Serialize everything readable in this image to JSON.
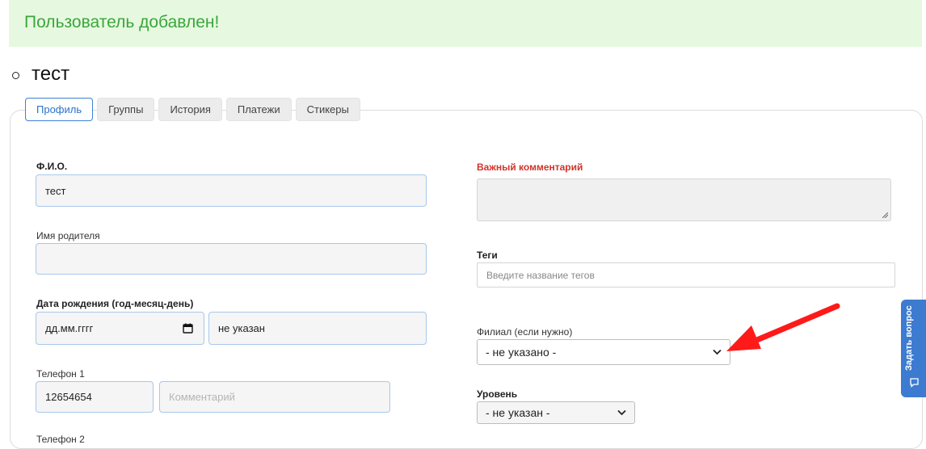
{
  "alert": {
    "message": "Пользователь добавлен!"
  },
  "page": {
    "title": "тест"
  },
  "tabs": [
    {
      "label": "Профиль",
      "active": true
    },
    {
      "label": "Группы",
      "active": false
    },
    {
      "label": "История",
      "active": false
    },
    {
      "label": "Платежи",
      "active": false
    },
    {
      "label": "Стикеры",
      "active": false
    }
  ],
  "form": {
    "fio": {
      "label": "Ф.И.О.",
      "value": "тест"
    },
    "parent_name": {
      "label": "Имя родителя",
      "value": ""
    },
    "birth_date": {
      "label": "Дата рождения (год-месяц-день)",
      "value": "дд.мм.гггг",
      "age": "не указан"
    },
    "phone1": {
      "label": "Телефон 1",
      "value": "12654654",
      "comment_placeholder": "Комментарий"
    },
    "phone2": {
      "label": "Телефон 2"
    },
    "important_comment": {
      "label": "Важный комментарий",
      "value": ""
    },
    "tags": {
      "label": "Теги",
      "placeholder": "Введите название тегов"
    },
    "branch": {
      "label": "Филиал (если нужно)",
      "selected": "- не указано -"
    },
    "level": {
      "label": "Уровень",
      "selected": "- не указан -"
    }
  },
  "help_widget": {
    "label": "Задать вопрос",
    "icon": "chat-bubble-icon"
  },
  "colors": {
    "alert_bg": "#e6f9e0",
    "alert_text": "#3ba63b",
    "accent": "#3b82d6",
    "annotation_arrow": "#ff1a1a",
    "important": "#d0342c"
  }
}
